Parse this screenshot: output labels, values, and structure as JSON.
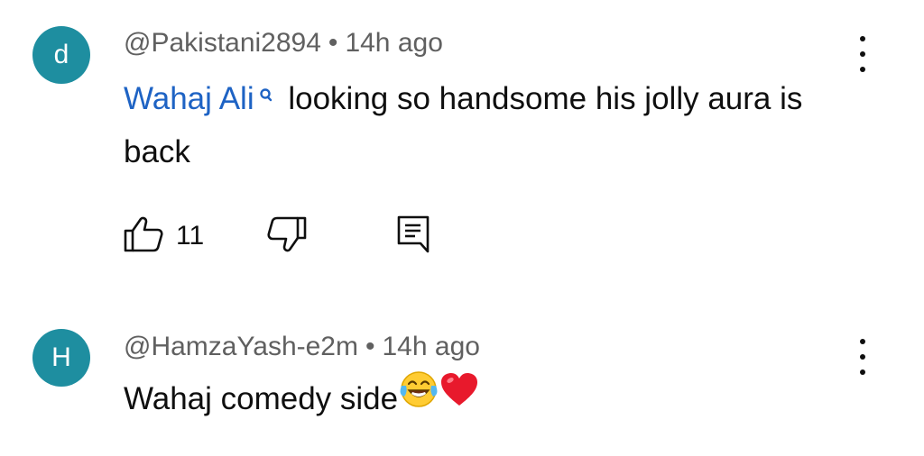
{
  "comments": [
    {
      "avatar_letter": "d",
      "avatar_color": "#1e8ea0",
      "author": "@Pakistani2894",
      "separator": "•",
      "time": "14h ago",
      "mention": "Wahaj Ali",
      "body": "looking so handsome his jolly aura is back",
      "like_count": "11",
      "icons": {
        "like": "thumbs-up-icon",
        "dislike": "thumbs-down-icon",
        "reply": "comment-icon",
        "more": "more-vertical-icon"
      }
    },
    {
      "avatar_letter": "H",
      "avatar_color": "#1e8ea0",
      "author": "@HamzaYash-e2m",
      "separator": "•",
      "time": "14h ago",
      "body": "Wahaj comedy side",
      "emojis": [
        "face-with-tears-of-joy-emoji",
        "red-heart-emoji"
      ],
      "icons": {
        "more": "more-vertical-icon"
      }
    }
  ],
  "colors": {
    "mention": "#1e63c4",
    "meta_text": "#606060",
    "body_text": "#0f0f0f"
  }
}
